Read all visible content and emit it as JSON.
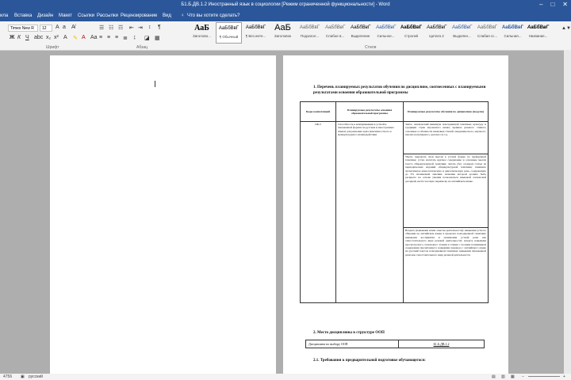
{
  "window": {
    "title": "Б1.Б.ДВ.1.2 Иностранный язык в социологии [Режим ограниченной функциональности] - Word"
  },
  "menu": {
    "items": [
      "ила",
      "Вставка",
      "Дизайн",
      "Макет",
      "Ссылки",
      "Рассылки",
      "Рецензирование",
      "Вид"
    ],
    "tell_me": "Что вы хотите сделать?"
  },
  "ribbon": {
    "font_name": "Times New R",
    "font_size": "12",
    "group_font": "Шрифт",
    "group_paragraph": "Абзац",
    "group_styles": "Стили",
    "styles": [
      {
        "sample": "AaБ",
        "name": "Заголово..."
      },
      {
        "sample": "AaБбВвГ",
        "name": "¶ Обычный"
      },
      {
        "sample": "AaБбВвГ",
        "name": "¶ Без инте..."
      },
      {
        "sample": "AaБ",
        "name": "Заголовок"
      },
      {
        "sample": "AaБбВвГ",
        "name": "Подзагол..."
      },
      {
        "sample": "AaБбВвГ",
        "name": "Слабое в..."
      },
      {
        "sample": "AaБбВвГ",
        "name": "Выделение"
      },
      {
        "sample": "AaБбВвГ",
        "name": "Сильное..."
      },
      {
        "sample": "AaБбВвГ",
        "name": "Строгий"
      },
      {
        "sample": "AaБбВвГ",
        "name": "Цитата 2"
      },
      {
        "sample": "AaБбВвГ",
        "name": "Выделен..."
      },
      {
        "sample": "AaБбВвГ",
        "name": "Слабая сс..."
      },
      {
        "sample": "AaБбВвГ",
        "name": "Сильная..."
      },
      {
        "sample": "AaБбВвГ",
        "name": "Название..."
      }
    ]
  },
  "document": {
    "heading1": "1. Перечень планируемых результатов обучения по дисциплине, соотнесенных с планируемыми результатами освоения образовательной программы",
    "table1": {
      "headers": [
        "Коды компетенций",
        "Планируемые результаты освоения образовательной программы",
        "Планируемые результаты обучения по дисциплине (модулю)"
      ],
      "code": "ОК-5",
      "outcome": "Способность к коммуникации в устной и письменной формах на русском и иностранных языках для решения задач межличностного и межкультурного взаимодействия",
      "know": "Знать: лексический минимум повседневной тематики; культуру и традиции стран изучаемого языка; правила речевого этикета; основные особенности языковых стилей: академического, научного, научно-популярного, делового и т.д.",
      "able": "Уметь: выражать свои мысли в устной форме по пройденной тематике; устно излагать краткое содержание и основные мысли текста общекультурной тематики; читать (без словаря) статьи из периодических изданий общекультурной тематики; понимать аутентичную монологическую и диалогическую речь, содержащую до 3% незнакомой лексики, значение которой должно быть раскрыто на основе умения пользоваться языковой логической догадкой, вести часовую переписку на английском языке.",
      "possess": "Владеть (навыками и/или опытом деятельности): навыками устного общения на английском языке в пределах повседневной тематики; навыками восприятия и понимания устной речи как самостоятельного вида речевой деятельности; владеть навыками просмотрового, поискового чтения и чтения с полным пониманием содержания прочитанного; навыками перевода с английского языка на русский текстов повседневной тематики; навыками письменной речи как самостоятельного вида речевой деятельности."
    },
    "heading2": "2. Место дисциплины в структуре ООП",
    "table2": {
      "label": "Дисциплина по выбору ООП",
      "code": "Б1.Б.ДВ.1.2"
    },
    "heading3": "2.1. Требования к предварительной подготовке обучающегося:"
  },
  "status": {
    "words": "4756",
    "language": "русский"
  }
}
